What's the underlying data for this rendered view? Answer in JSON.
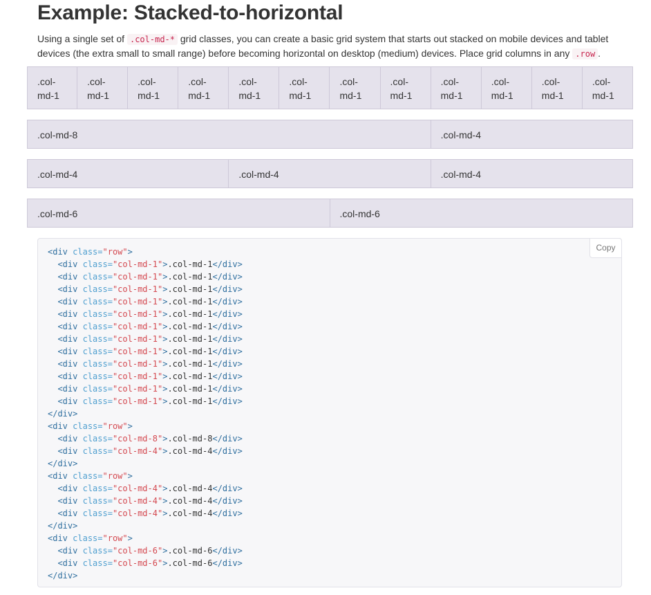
{
  "heading": "Example: Stacked-to-horizontal",
  "lead": {
    "part1": "Using a single set of ",
    "code1": ".col-md-*",
    "part2": " grid classes, you can create a basic grid system that starts out stacked on mobile devices and tablet devices (the extra small to small range) before becoming horizontal on desktop (medium) devices. Place grid columns in any ",
    "code2": ".row",
    "part3": "."
  },
  "grid_rows": [
    {
      "cells": [
        {
          "label": ".col-md-1",
          "span": 1
        },
        {
          "label": ".col-md-1",
          "span": 1
        },
        {
          "label": ".col-md-1",
          "span": 1
        },
        {
          "label": ".col-md-1",
          "span": 1
        },
        {
          "label": ".col-md-1",
          "span": 1
        },
        {
          "label": ".col-md-1",
          "span": 1
        },
        {
          "label": ".col-md-1",
          "span": 1
        },
        {
          "label": ".col-md-1",
          "span": 1
        },
        {
          "label": ".col-md-1",
          "span": 1
        },
        {
          "label": ".col-md-1",
          "span": 1
        },
        {
          "label": ".col-md-1",
          "span": 1
        },
        {
          "label": ".col-md-1",
          "span": 1
        }
      ]
    },
    {
      "cells": [
        {
          "label": ".col-md-8",
          "span": 8
        },
        {
          "label": ".col-md-4",
          "span": 4
        }
      ]
    },
    {
      "cells": [
        {
          "label": ".col-md-4",
          "span": 4
        },
        {
          "label": ".col-md-4",
          "span": 4
        },
        {
          "label": ".col-md-4",
          "span": 4
        }
      ]
    },
    {
      "cells": [
        {
          "label": ".col-md-6",
          "span": 6
        },
        {
          "label": ".col-md-6",
          "span": 6
        }
      ]
    }
  ],
  "copy_label": "Copy",
  "code_lines": [
    {
      "indent": "",
      "kind": "open-row",
      "tag": "div",
      "attr": "class",
      "value": "row",
      "text": ""
    },
    {
      "indent": "  ",
      "kind": "col",
      "tag": "div",
      "attr": "class",
      "value": "col-md-1",
      "text": ".col-md-1"
    },
    {
      "indent": "  ",
      "kind": "col",
      "tag": "div",
      "attr": "class",
      "value": "col-md-1",
      "text": ".col-md-1"
    },
    {
      "indent": "  ",
      "kind": "col",
      "tag": "div",
      "attr": "class",
      "value": "col-md-1",
      "text": ".col-md-1"
    },
    {
      "indent": "  ",
      "kind": "col",
      "tag": "div",
      "attr": "class",
      "value": "col-md-1",
      "text": ".col-md-1"
    },
    {
      "indent": "  ",
      "kind": "col",
      "tag": "div",
      "attr": "class",
      "value": "col-md-1",
      "text": ".col-md-1"
    },
    {
      "indent": "  ",
      "kind": "col",
      "tag": "div",
      "attr": "class",
      "value": "col-md-1",
      "text": ".col-md-1"
    },
    {
      "indent": "  ",
      "kind": "col",
      "tag": "div",
      "attr": "class",
      "value": "col-md-1",
      "text": ".col-md-1"
    },
    {
      "indent": "  ",
      "kind": "col",
      "tag": "div",
      "attr": "class",
      "value": "col-md-1",
      "text": ".col-md-1"
    },
    {
      "indent": "  ",
      "kind": "col",
      "tag": "div",
      "attr": "class",
      "value": "col-md-1",
      "text": ".col-md-1"
    },
    {
      "indent": "  ",
      "kind": "col",
      "tag": "div",
      "attr": "class",
      "value": "col-md-1",
      "text": ".col-md-1"
    },
    {
      "indent": "  ",
      "kind": "col",
      "tag": "div",
      "attr": "class",
      "value": "col-md-1",
      "text": ".col-md-1"
    },
    {
      "indent": "  ",
      "kind": "col",
      "tag": "div",
      "attr": "class",
      "value": "col-md-1",
      "text": ".col-md-1"
    },
    {
      "indent": "",
      "kind": "close",
      "tag": "div"
    },
    {
      "indent": "",
      "kind": "open-row",
      "tag": "div",
      "attr": "class",
      "value": "row",
      "text": ""
    },
    {
      "indent": "  ",
      "kind": "col",
      "tag": "div",
      "attr": "class",
      "value": "col-md-8",
      "text": ".col-md-8"
    },
    {
      "indent": "  ",
      "kind": "col",
      "tag": "div",
      "attr": "class",
      "value": "col-md-4",
      "text": ".col-md-4"
    },
    {
      "indent": "",
      "kind": "close",
      "tag": "div"
    },
    {
      "indent": "",
      "kind": "open-row",
      "tag": "div",
      "attr": "class",
      "value": "row",
      "text": ""
    },
    {
      "indent": "  ",
      "kind": "col",
      "tag": "div",
      "attr": "class",
      "value": "col-md-4",
      "text": ".col-md-4"
    },
    {
      "indent": "  ",
      "kind": "col",
      "tag": "div",
      "attr": "class",
      "value": "col-md-4",
      "text": ".col-md-4"
    },
    {
      "indent": "  ",
      "kind": "col",
      "tag": "div",
      "attr": "class",
      "value": "col-md-4",
      "text": ".col-md-4"
    },
    {
      "indent": "",
      "kind": "close",
      "tag": "div"
    },
    {
      "indent": "",
      "kind": "open-row",
      "tag": "div",
      "attr": "class",
      "value": "row",
      "text": ""
    },
    {
      "indent": "  ",
      "kind": "col",
      "tag": "div",
      "attr": "class",
      "value": "col-md-6",
      "text": ".col-md-6"
    },
    {
      "indent": "  ",
      "kind": "col",
      "tag": "div",
      "attr": "class",
      "value": "col-md-6",
      "text": ".col-md-6"
    },
    {
      "indent": "",
      "kind": "close",
      "tag": "div"
    }
  ],
  "colors": {
    "grid_cell_bg": "#e5e2ec",
    "grid_cell_border": "#cdc8d8",
    "code_tag": "#2f6f9f",
    "code_attr": "#4f9fcf",
    "code_string": "#d44950",
    "inline_code": "#c7254e"
  }
}
